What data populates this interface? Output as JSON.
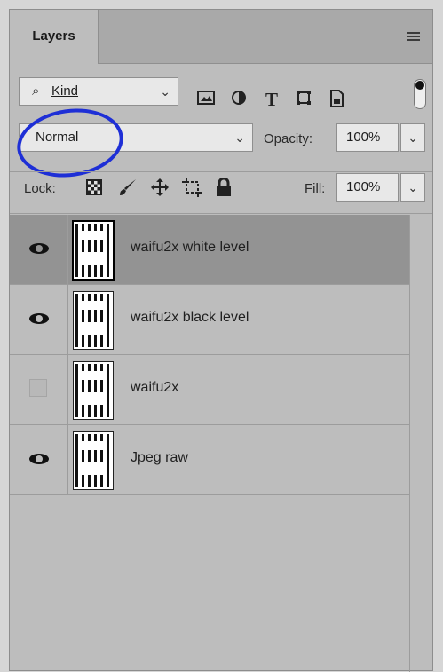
{
  "panel": {
    "tab_label": "Layers",
    "menu_icon": "panel-menu-icon"
  },
  "filter": {
    "label": "Kind",
    "icons": [
      "image-filter-icon",
      "adjustment-filter-icon",
      "type-filter-icon",
      "shape-filter-icon",
      "smart-object-filter-icon",
      "filter-toggle-icon"
    ]
  },
  "blend": {
    "mode": "Normal",
    "opacity_label": "Opacity:",
    "opacity_value": "100%"
  },
  "lock": {
    "label": "Lock:",
    "icons": [
      "lock-transparent-icon",
      "lock-image-icon",
      "lock-position-icon",
      "lock-artboard-icon",
      "lock-all-icon"
    ],
    "fill_label": "Fill:",
    "fill_value": "100%"
  },
  "layers": [
    {
      "name": "waifu2x white level",
      "visible": true,
      "selected": true
    },
    {
      "name": "waifu2x black level",
      "visible": true,
      "selected": false
    },
    {
      "name": "waifu2x",
      "visible": false,
      "selected": false
    },
    {
      "name": "Jpeg raw",
      "visible": true,
      "selected": false
    }
  ],
  "colors": {
    "panel_bg": "#bdbdbd",
    "selected_row": "#939393",
    "annotation_circle": "#1e2fd6"
  }
}
